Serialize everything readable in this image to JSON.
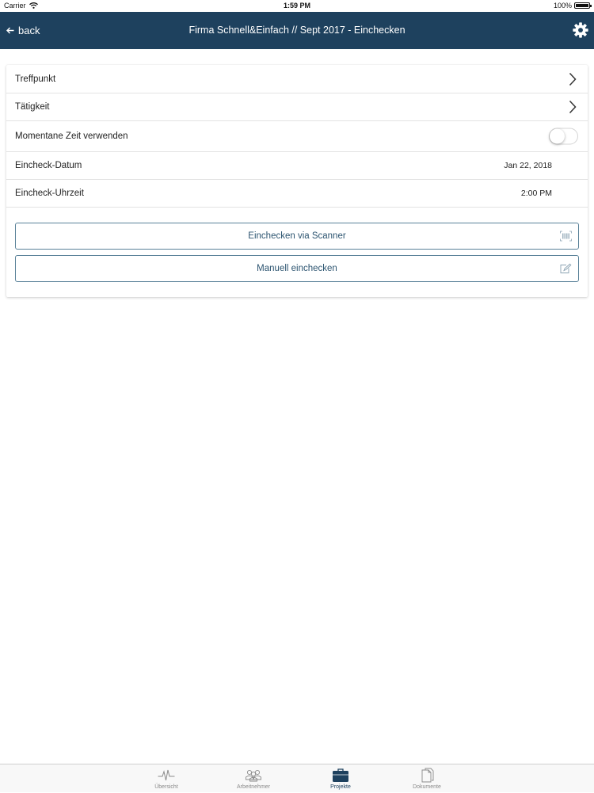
{
  "status_bar": {
    "carrier": "Carrier",
    "time": "1:59 PM",
    "battery": "100%",
    "battery_level": 1.0
  },
  "nav": {
    "back_label": "back",
    "title": "Firma Schnell&Einfach // Sept 2017 - Einchecken",
    "settings_icon": "gear-icon"
  },
  "form": {
    "treffpunkt_label": "Treffpunkt",
    "taetigkeit_label": "Tätigkeit",
    "current_time_label": "Momentane Zeit verwenden",
    "current_time_enabled": false,
    "date_label": "Eincheck-Datum",
    "date_value": "Jan 22, 2018",
    "time_label": "Eincheck-Uhrzeit",
    "time_value": "2:00 PM"
  },
  "actions": {
    "scanner_label": "Einchecken via Scanner",
    "scanner_icon": "barcode-icon",
    "manual_label": "Manuell einchecken",
    "manual_icon": "edit-icon"
  },
  "tabs": [
    {
      "label": "Übersicht",
      "icon": "pulse-icon",
      "active": false
    },
    {
      "label": "Arbeitnehmer",
      "icon": "people-icon",
      "active": false
    },
    {
      "label": "Projekte",
      "icon": "briefcase-icon",
      "active": true
    },
    {
      "label": "Dokumente",
      "icon": "document-icon",
      "active": false
    }
  ],
  "colors": {
    "nav_background": "#1e415e",
    "button_border": "#5a8299",
    "button_text": "#2c5470",
    "tab_active": "#1e415e",
    "tab_inactive": "#8a8a8a"
  }
}
